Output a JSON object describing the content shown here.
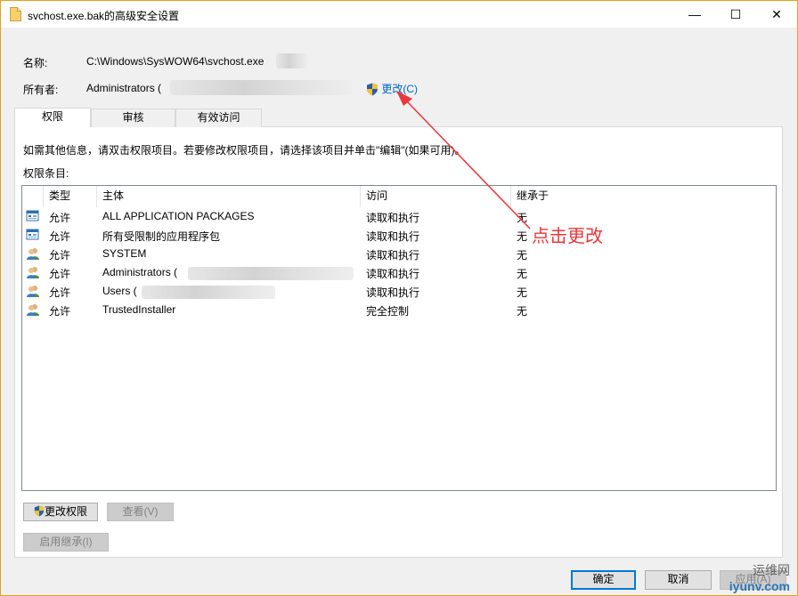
{
  "window": {
    "title": "svchost.exe.bak的高级安全设置",
    "minimize_glyph": "—",
    "maximize_glyph": "☐",
    "close_glyph": "✕"
  },
  "info": {
    "name_label": "名称:",
    "name_value": "C:\\Windows\\SysWOW64\\svchost.exe",
    "owner_label": "所有者:",
    "owner_value": "Administrators (",
    "change_link": "更改(C)"
  },
  "tabs": [
    {
      "label": "权限"
    },
    {
      "label": "审核"
    },
    {
      "label": "有效访问"
    }
  ],
  "panel": {
    "hint": "如需其他信息，请双击权限项目。若要修改权限项目，请选择该项目并单击\"编辑\"(如果可用)。",
    "entries_label": "权限条目:"
  },
  "table": {
    "headers": [
      "类型",
      "主体",
      "访问",
      "继承于"
    ],
    "rows": [
      {
        "icon": "app-packages-icon",
        "type": "允许",
        "principal": "ALL APPLICATION PACKAGES",
        "access": "读取和执行",
        "inherited": "无"
      },
      {
        "icon": "app-packages-icon",
        "type": "允许",
        "principal": "所有受限制的应用程序包",
        "access": "读取和执行",
        "inherited": "无"
      },
      {
        "icon": "users-icon",
        "type": "允许",
        "principal": "SYSTEM",
        "access": "读取和执行",
        "inherited": "无"
      },
      {
        "icon": "users-icon",
        "type": "允许",
        "principal": "Administrators (",
        "access": "读取和执行",
        "inherited": "无"
      },
      {
        "icon": "users-icon",
        "type": "允许",
        "principal": "Users (",
        "access": "读取和执行",
        "inherited": "无"
      },
      {
        "icon": "users-icon",
        "type": "允许",
        "principal": "TrustedInstaller",
        "access": "完全控制",
        "inherited": "无"
      }
    ]
  },
  "buttons": {
    "change_permissions": "更改权限",
    "view": "查看(V)",
    "enable_inheritance": "启用继承(I)",
    "ok": "确定",
    "cancel": "取消",
    "apply": "应用(A)"
  },
  "annotation": {
    "text": "点击更改",
    "color": "#e8383b"
  },
  "watermark": {
    "line1": "运维网",
    "line2": "iyunv.com"
  }
}
